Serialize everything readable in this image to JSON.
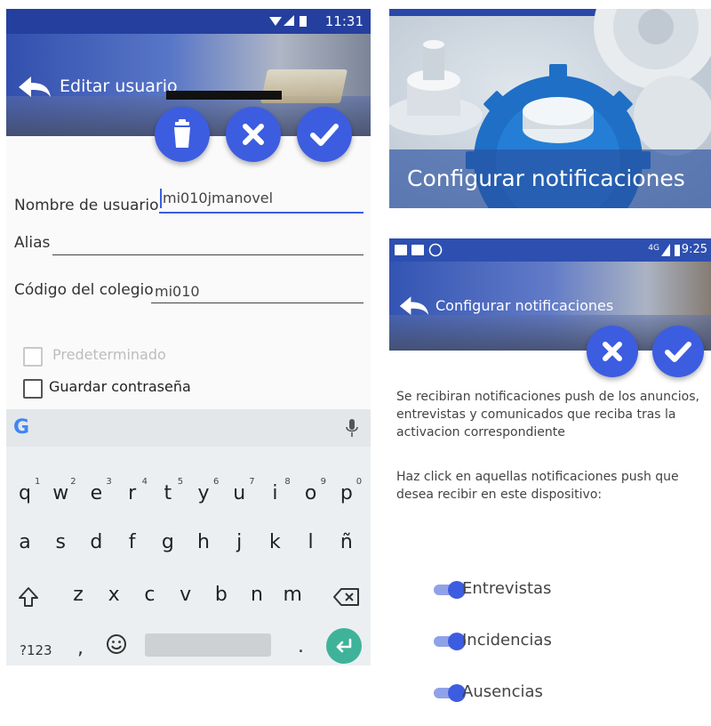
{
  "left": {
    "status_time": "11:31",
    "title": "Editar usuario",
    "fields": {
      "username_label": "Nombre de usuario",
      "username_value": "mi010jmanovel",
      "alias_label": "Alias",
      "alias_value": "",
      "school_label": "Código del colegio",
      "school_value": "mi010"
    },
    "checkboxes": {
      "default_label": "Predeterminado",
      "save_password_label": "Guardar contraseña"
    },
    "keyboard": {
      "row1": [
        "q",
        "w",
        "e",
        "r",
        "t",
        "y",
        "u",
        "i",
        "o",
        "p"
      ],
      "row1_nums": [
        "1",
        "2",
        "3",
        "4",
        "5",
        "6",
        "7",
        "8",
        "9",
        "0"
      ],
      "row2": [
        "a",
        "s",
        "d",
        "f",
        "g",
        "h",
        "j",
        "k",
        "l",
        "ñ"
      ],
      "row3": [
        "z",
        "x",
        "c",
        "v",
        "b",
        "n",
        "m"
      ],
      "symbols_key": "?123",
      "comma": ",",
      "period": ".",
      "google_letter": "G"
    }
  },
  "right_top": {
    "caption": "Configurar notificaciones"
  },
  "right_bottom": {
    "status_time": "9:25",
    "status_net": "4G",
    "title": "Configurar notificaciones",
    "paragraph1": "Se recibiran notificaciones push de los anuncios, entrevistas y comunicados que reciba tras la activacion correspondiente",
    "paragraph2": "Haz click en aquellas notificaciones push que desea recibir en este dispositivo:",
    "toggles": [
      {
        "label": "Entrevistas",
        "on": true
      },
      {
        "label": "Incidencias",
        "on": true
      },
      {
        "label": "Ausencias",
        "on": true
      }
    ]
  },
  "colors": {
    "primary": "#3d5de0",
    "status_bar": "#243f9e",
    "enter_key": "#3fb39a"
  }
}
